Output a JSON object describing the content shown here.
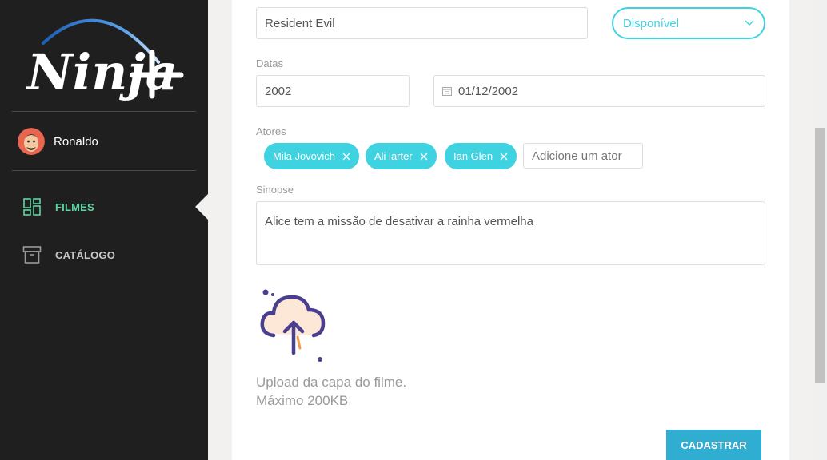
{
  "brand": {
    "logo_text": "Ninja+"
  },
  "user": {
    "name": "Ronaldo"
  },
  "nav": {
    "items": [
      {
        "label": "FILMES",
        "icon": "dashboard-icon",
        "active": true
      },
      {
        "label": "CATÁLOGO",
        "icon": "archive-icon",
        "active": false
      }
    ]
  },
  "form": {
    "title_value": "Resident Evil",
    "status_value": "Disponível",
    "dates_label": "Datas",
    "year_value": "2002",
    "release_date_value": "01/12/2002",
    "actors_label": "Atores",
    "actors": [
      "Mila Jovovich",
      "Ali larter",
      "Ian Glen"
    ],
    "actor_placeholder": "Adicione um ator",
    "synopsis_label": "Sinopse",
    "synopsis_value": "Alice tem a missão de desativar a rainha vermelha",
    "upload_text": "Upload da capa do filme. Máximo 200KB",
    "submit_label": "CADASTRAR"
  },
  "colors": {
    "accent": "#3fd3e2",
    "active_nav": "#5fd6a2",
    "button": "#2faed2",
    "sidebar": "#1f1f1f"
  }
}
